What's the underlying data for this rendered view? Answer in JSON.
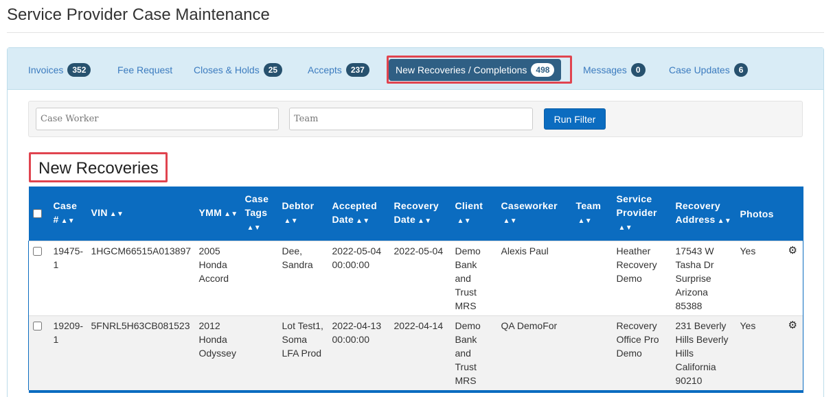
{
  "page": {
    "title": "Service Provider Case Maintenance"
  },
  "tabs": [
    {
      "label": "Invoices",
      "count": "352"
    },
    {
      "label": "Fee Request",
      "count": ""
    },
    {
      "label": "Closes & Holds",
      "count": "25"
    },
    {
      "label": "Accepts",
      "count": "237"
    },
    {
      "label": "New Recoveries / Completions",
      "count": "498",
      "active": true
    },
    {
      "label": "Messages",
      "count": "0"
    },
    {
      "label": "Case Updates",
      "count": "6"
    }
  ],
  "filter": {
    "caseworker_placeholder": "Case Worker",
    "team_placeholder": "Team",
    "run_label": "Run Filter"
  },
  "section": {
    "title": "New Recoveries"
  },
  "table": {
    "headers": {
      "case": "Case #",
      "vin": "VIN",
      "ymm": "YMM",
      "tags": "Case Tags",
      "debtor": "Debtor",
      "accepted": "Accepted Date",
      "recovery": "Recovery Date",
      "client": "Client",
      "caseworker": "Caseworker",
      "team": "Team",
      "provider": "Service Provider",
      "address": "Recovery Address",
      "photos": "Photos"
    },
    "rows": [
      {
        "case": "19475-1",
        "vin": "1HGCM66515A013897",
        "ymm": "2005 Honda Accord",
        "tags": "",
        "debtor": "Dee, Sandra",
        "accepted": "2022-05-04 00:00:00",
        "recovery": "2022-05-04",
        "client": "Demo Bank and Trust MRS",
        "caseworker": "Alexis Paul",
        "team": "",
        "provider": "Heather Recovery Demo",
        "address": "17543 W Tasha Dr Surprise Arizona 85388",
        "photos": "Yes"
      },
      {
        "case": "19209-1",
        "vin": "5FNRL5H63CB081523",
        "ymm": "2012 Honda Odyssey",
        "tags": "",
        "debtor": "Lot Test1, Soma LFA Prod",
        "accepted": "2022-04-13 00:00:00",
        "recovery": "2022-04-14",
        "client": "Demo Bank and Trust MRS",
        "caseworker": "QA DemoFor",
        "team": "",
        "provider": "Recovery Office Pro Demo",
        "address": "231 Beverly Hills Beverly Hills California 90210",
        "photos": "Yes"
      }
    ]
  },
  "icons": {
    "sort": "sort-icon",
    "row_action": "gear-icon"
  },
  "colors": {
    "header_blue": "#0b6cc0",
    "tabbar_bg": "#d9ecf6",
    "active_tab": "#2f5f84",
    "badge": "#27516e",
    "callout_red": "#e0444f"
  }
}
